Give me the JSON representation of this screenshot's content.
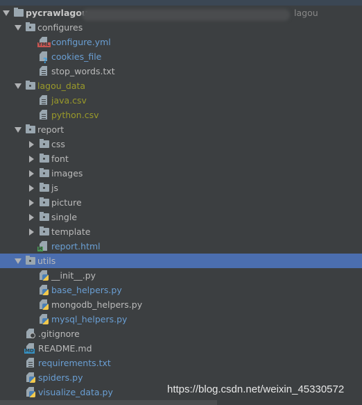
{
  "project": {
    "name": "pycrawlagou",
    "path_suffix": "lagou"
  },
  "tree": [
    {
      "label": "pycrawlagou",
      "kind": "folder",
      "level": 0,
      "expanded": true,
      "style": "bold"
    },
    {
      "label": "configures",
      "kind": "folder",
      "level": 1,
      "expanded": true
    },
    {
      "label": "configure.yml",
      "kind": "yml",
      "level": 2,
      "style": "blue"
    },
    {
      "label": "cookies_file",
      "kind": "unknown",
      "level": 2,
      "style": "blue"
    },
    {
      "label": "stop_words.txt",
      "kind": "text",
      "level": 2
    },
    {
      "label": "lagou_data",
      "kind": "folder",
      "level": 1,
      "expanded": true,
      "style": "olive"
    },
    {
      "label": "java.csv",
      "kind": "text",
      "level": 2,
      "style": "olive"
    },
    {
      "label": "python.csv",
      "kind": "text",
      "level": 2,
      "style": "olive"
    },
    {
      "label": "report",
      "kind": "folder",
      "level": 1,
      "expanded": true
    },
    {
      "label": "css",
      "kind": "folder",
      "level": 2,
      "expanded": false
    },
    {
      "label": "font",
      "kind": "folder",
      "level": 2,
      "expanded": false
    },
    {
      "label": "images",
      "kind": "folder",
      "level": 2,
      "expanded": false
    },
    {
      "label": "js",
      "kind": "folder",
      "level": 2,
      "expanded": false
    },
    {
      "label": "picture",
      "kind": "folder",
      "level": 2,
      "expanded": false
    },
    {
      "label": "single",
      "kind": "folder",
      "level": 2,
      "expanded": false
    },
    {
      "label": "template",
      "kind": "folder",
      "level": 2,
      "expanded": false
    },
    {
      "label": "report.html",
      "kind": "html",
      "level": 2,
      "style": "blue"
    },
    {
      "label": "utils",
      "kind": "folder",
      "level": 1,
      "expanded": true,
      "selected": true
    },
    {
      "label": "__init__.py",
      "kind": "python",
      "level": 2
    },
    {
      "label": "base_helpers.py",
      "kind": "python",
      "level": 2,
      "style": "blue"
    },
    {
      "label": "mongodb_helpers.py",
      "kind": "python",
      "level": 2
    },
    {
      "label": "mysql_helpers.py",
      "kind": "python",
      "level": 2,
      "style": "blue"
    },
    {
      "label": ".gitignore",
      "kind": "ignore",
      "level": 1
    },
    {
      "label": "README.md",
      "kind": "md",
      "level": 1
    },
    {
      "label": "requirements.txt",
      "kind": "text",
      "level": 1,
      "style": "blue"
    },
    {
      "label": "spiders.py",
      "kind": "python",
      "level": 1,
      "style": "blue"
    },
    {
      "label": "visualize_data.py",
      "kind": "python",
      "level": 1,
      "style": "blue"
    }
  ],
  "badges": {
    "yml": "YML",
    "md": "MD",
    "html": "H"
  },
  "colors": {
    "background": "#3c3f41",
    "selection": "#4b6eaf",
    "modified": "#6a9fd4",
    "untracked": "#9a9a2a",
    "text": "#bbbbbb"
  },
  "watermark": "https://blog.csdn.net/weixin_45330572"
}
